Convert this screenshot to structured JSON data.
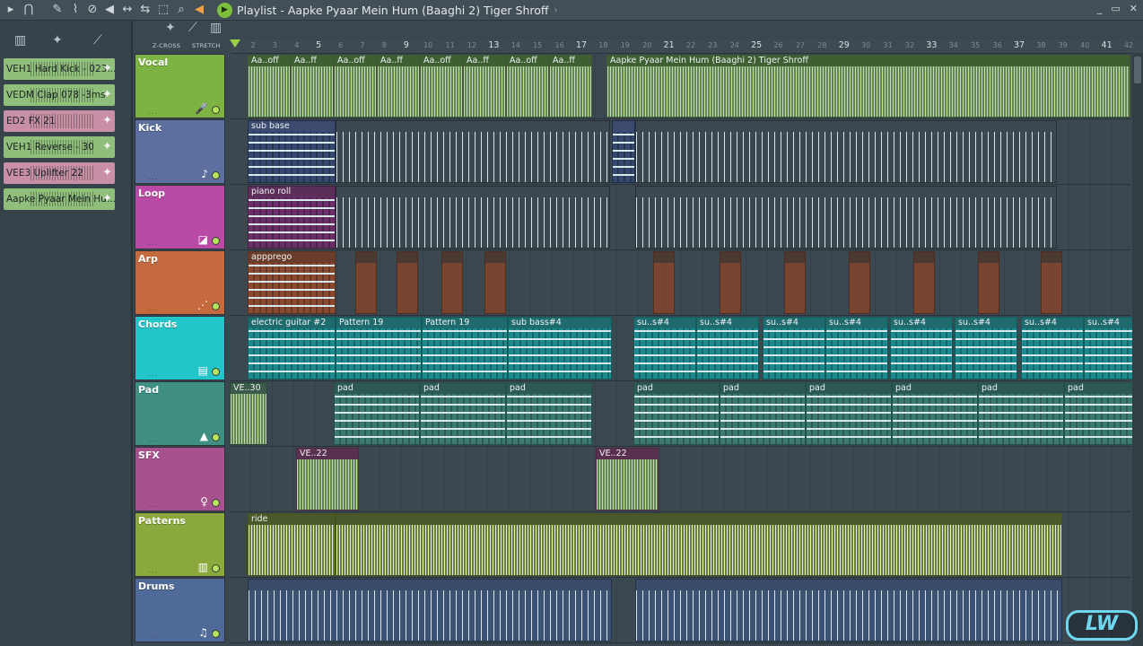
{
  "window": {
    "title": "Playlist - Aapke Pyaar Mein Hum (Baaghi 2) Tiger Shroff",
    "title_arrow": "›",
    "minimize": "_",
    "restore": "▭",
    "close": "✕"
  },
  "toolbar_icons": [
    "menu-arrow-icon",
    "magnet-icon",
    "pencil-icon",
    "brush-icon",
    "mute-icon",
    "speaker-icon",
    "slip-icon",
    "select-icon",
    "zoom-icon",
    "audio-icon",
    "play-icon"
  ],
  "ruler_options": {
    "zcross": "Z-CROSS",
    "stretch": "STRETCH"
  },
  "bars": [
    "2",
    "3",
    "4",
    "5",
    "6",
    "7",
    "8",
    "9",
    "10",
    "11",
    "12",
    "13",
    "14",
    "15",
    "16",
    "17",
    "18",
    "19",
    "20",
    "21",
    "22",
    "23",
    "24",
    "25",
    "26",
    "27",
    "28",
    "29",
    "30",
    "31",
    "32",
    "33",
    "34",
    "35",
    "36",
    "37",
    "38",
    "39",
    "40",
    "41",
    "42"
  ],
  "browser_clips": [
    {
      "name": "VEH1 Hard Kick - 023...",
      "color": "#8fbf7a"
    },
    {
      "name": "VEDM Clap 078 -3ms",
      "color": "#8fbf7a"
    },
    {
      "name": "ED2 FX 21",
      "color": "#c98fa6"
    },
    {
      "name": "VEH1 Reverse - 30",
      "color": "#8fbf7a"
    },
    {
      "name": "VEE3 Uplifter 22",
      "color": "#c98fa6"
    },
    {
      "name": "Aapke Pyaar Mein Hu...",
      "color": "#8fbf7a"
    }
  ],
  "tracks": [
    {
      "name": "Vocal",
      "color": "#7cb342",
      "icon": "microphone-icon",
      "glyph": "🎤"
    },
    {
      "name": "Kick",
      "color": "#5c6f9e",
      "icon": "drum-icon",
      "glyph": "♪"
    },
    {
      "name": "Loop",
      "color": "#b94aa6",
      "icon": "loop-icon",
      "glyph": "◪"
    },
    {
      "name": "Arp",
      "color": "#c56a3e",
      "icon": "arp-icon",
      "glyph": "⋰"
    },
    {
      "name": "Chords",
      "color": "#22c5c9",
      "icon": "pattern-icon",
      "glyph": "▤"
    },
    {
      "name": "Pad",
      "color": "#3f8f83",
      "icon": "pad-icon",
      "glyph": "▲"
    },
    {
      "name": "SFX",
      "color": "#a8518f",
      "icon": "sfx-icon",
      "glyph": "♀"
    },
    {
      "name": "Patterns",
      "color": "#8aa83c",
      "icon": "piano-icon",
      "glyph": "▥"
    },
    {
      "name": "Drums",
      "color": "#4f6a99",
      "icon": "drums-icon",
      "glyph": "♫"
    }
  ],
  "clip_labels": {
    "vocal_short": "Aa..off",
    "vocal_short2": "Aa..ff",
    "vocal_long": "Aapke Pyaar Mein Hum (Baaghi 2) Tiger Shroff",
    "kick": "sub base",
    "loop": "piano roll",
    "arp": "appprego",
    "chords1": "electric guitar #2",
    "chords2": "Pattern 19",
    "chords3": "Pattern 19",
    "chords4": "sub bass#4",
    "chords_short": "su..s#4",
    "pad_first": "VE..30",
    "pad": "pad",
    "sfx": "VE..22",
    "patterns": "ride"
  },
  "logo_text": "LW"
}
